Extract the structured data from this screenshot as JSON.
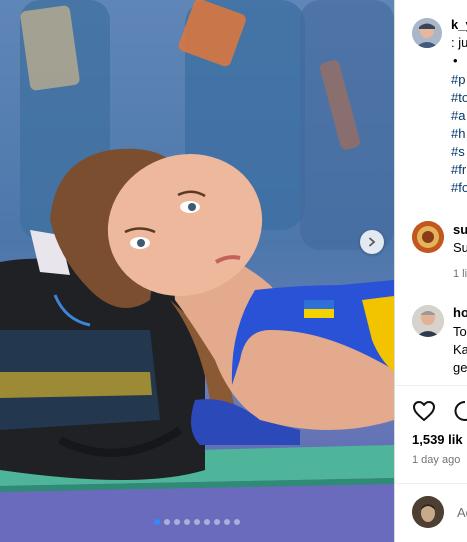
{
  "post": {
    "image_alt": "Athlete lying on a mat with her head resting on a sports bag",
    "carousel": {
      "total": 9,
      "active_index": 0
    }
  },
  "caption": {
    "username": "k_y",
    "first_line": ": ju",
    "bullet": "•",
    "hashtags": [
      "#p",
      "#to",
      "#a",
      "#h",
      "#s",
      "#fr",
      "#fo"
    ]
  },
  "comments": [
    {
      "username": "su",
      "text": "Su",
      "likes": "1 li"
    },
    {
      "username": "ho",
      "lines": [
        "To",
        "Ka",
        "ge"
      ]
    }
  ],
  "actions": {
    "likes": "1,539 lik",
    "time": "1 day ago"
  },
  "add_comment": {
    "placeholder": "Ad"
  },
  "colors": {
    "accent": "#2f8cff",
    "hashtag": "#00376b",
    "muted": "#737373"
  }
}
